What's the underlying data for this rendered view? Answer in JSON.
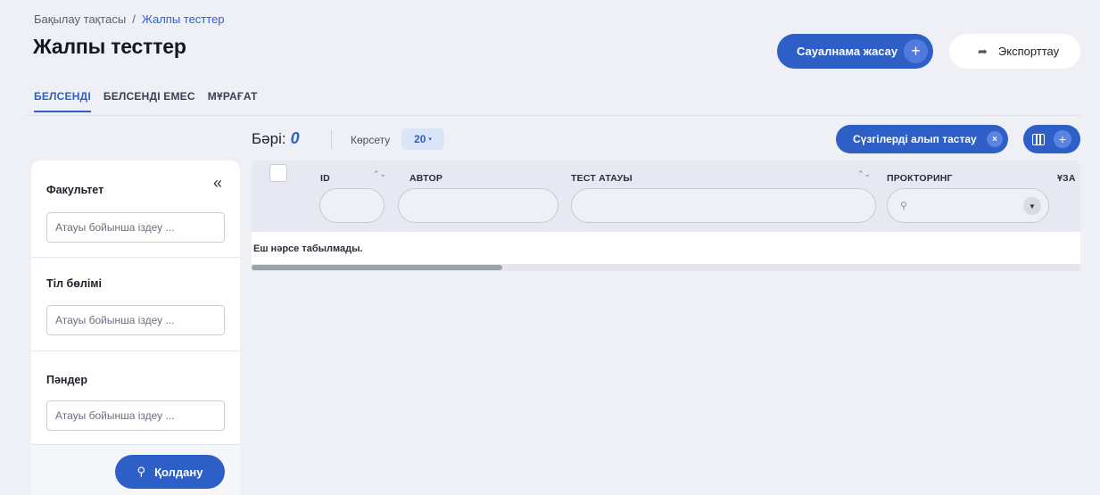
{
  "breadcrumb": {
    "parent": "Бақылау тақтасы",
    "separator": "/",
    "current": "Жалпы тесттер"
  },
  "page_title": "Жалпы тесттер",
  "header_actions": {
    "create_label": "Сауалнама жасау",
    "create_icon": "+",
    "export_label": "Экспорттау",
    "export_icon": "➦"
  },
  "tabs": [
    {
      "label": "БЕЛСЕНДІ",
      "active": true
    },
    {
      "label": "БЕЛСЕНДІ ЕМЕС",
      "active": false
    },
    {
      "label": "МҰРАҒАТ",
      "active": false
    }
  ],
  "toolbar": {
    "total_label": "Бәрі:",
    "total_count": "0",
    "show_label": "Көрсету",
    "page_size": "20",
    "page_size_caret": "▾",
    "clear_filters_label": "Сүзгілерді алып тастау",
    "clear_icon": "×",
    "columns_plus": "+"
  },
  "sidebar": {
    "collapse_icon": "«",
    "filters": [
      {
        "title": "Факультет",
        "placeholder": "Атауы бойынша іздеу ..."
      },
      {
        "title": "Тіл бөлімі",
        "placeholder": "Атауы бойынша іздеу ..."
      },
      {
        "title": "Пәндер",
        "placeholder": "Атауы бойынша іздеу ..."
      }
    ],
    "apply_label": "Қолдану",
    "apply_icon": "⚲"
  },
  "table": {
    "columns": [
      {
        "label": "ID"
      },
      {
        "label": "АВТОР"
      },
      {
        "label": "ТЕСТ АТАУЫ"
      },
      {
        "label": "ПРОКТОРИНГ"
      },
      {
        "label": "ҰЗА"
      }
    ],
    "sort_icon": "⌃⌄",
    "search_icon": "⚲",
    "dropdown_icon": "▼",
    "empty_message": "Еш нәрсе табылмады."
  },
  "colors": {
    "accent": "#2e5fc7",
    "background": "#eef0f6",
    "header_row": "#e6e9f1"
  }
}
